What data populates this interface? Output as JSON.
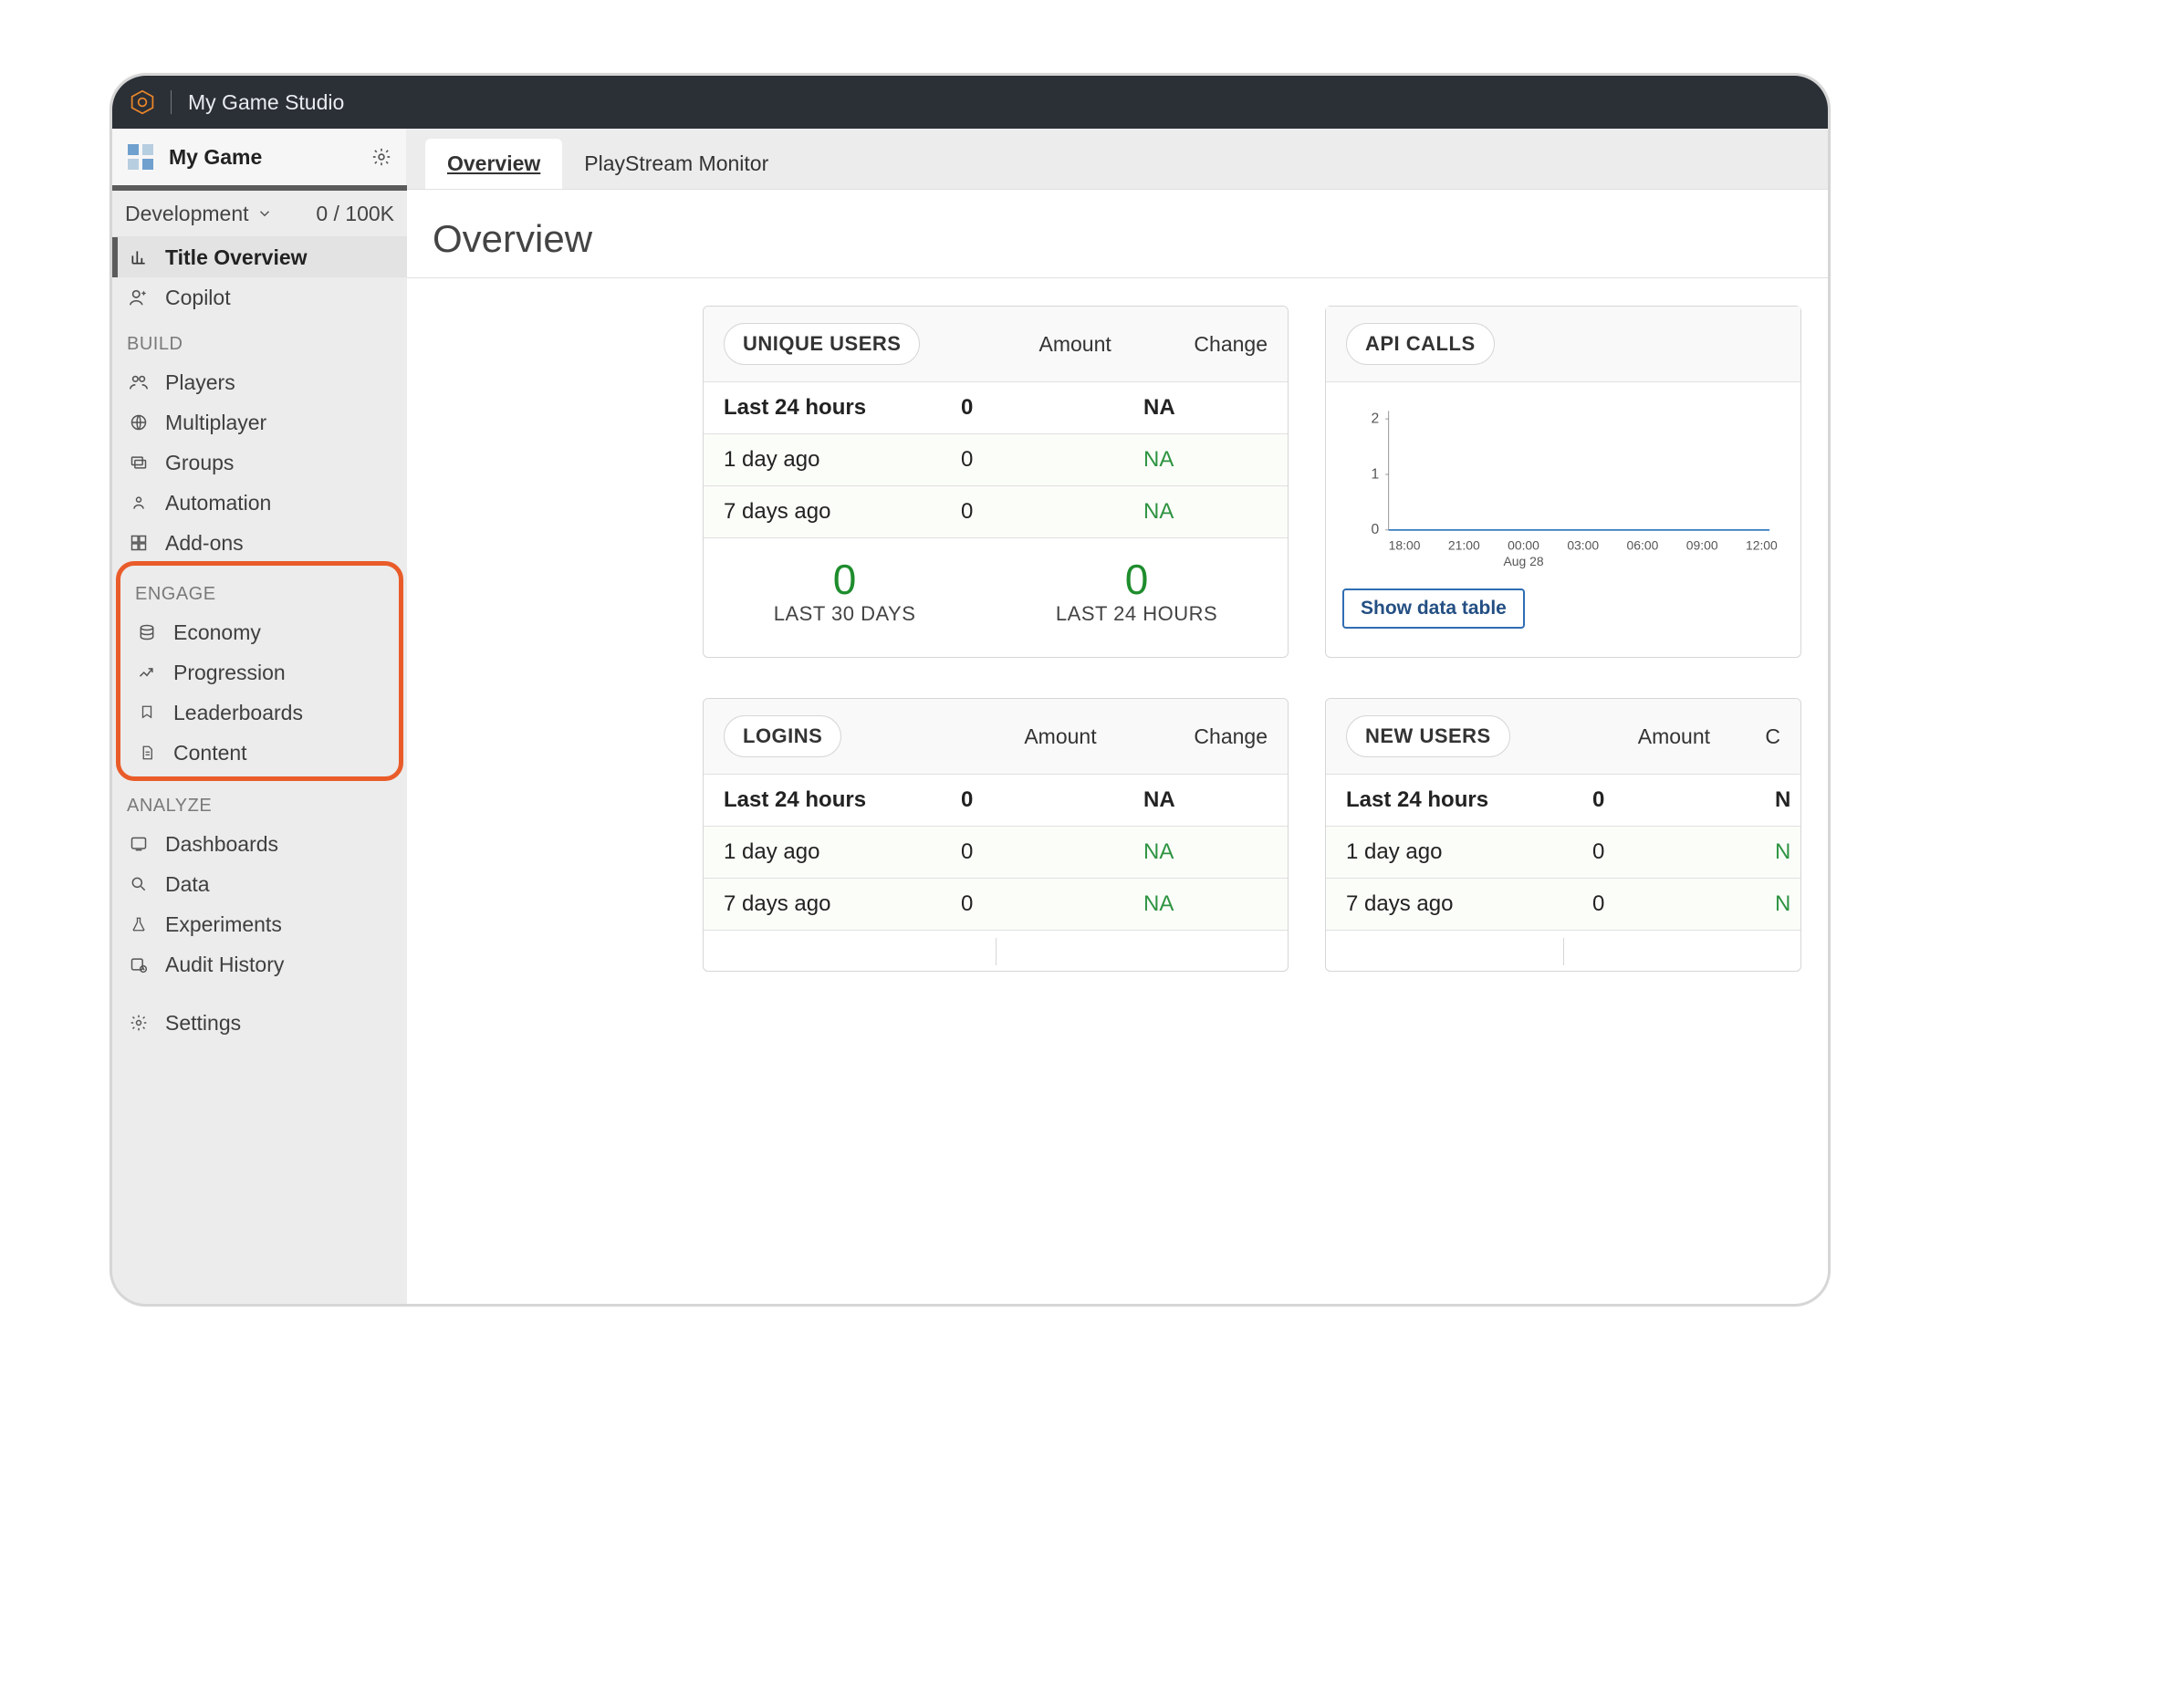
{
  "topbar": {
    "studio_name": "My Game Studio"
  },
  "sidebar": {
    "game_name": "My Game",
    "env_label": "Development",
    "env_ratio": "0 / 100K",
    "items": [
      {
        "label": "Title Overview"
      },
      {
        "label": "Copilot"
      }
    ],
    "sections": {
      "build": {
        "label": "BUILD",
        "items": [
          {
            "label": "Players"
          },
          {
            "label": "Multiplayer"
          },
          {
            "label": "Groups"
          },
          {
            "label": "Automation"
          },
          {
            "label": "Add-ons"
          }
        ]
      },
      "engage": {
        "label": "ENGAGE",
        "items": [
          {
            "label": "Economy"
          },
          {
            "label": "Progression"
          },
          {
            "label": "Leaderboards"
          },
          {
            "label": "Content"
          }
        ]
      },
      "analyze": {
        "label": "ANALYZE",
        "items": [
          {
            "label": "Dashboards"
          },
          {
            "label": "Data"
          },
          {
            "label": "Experiments"
          },
          {
            "label": "Audit History"
          }
        ]
      }
    },
    "settings_label": "Settings"
  },
  "tabs": [
    {
      "label": "Overview"
    },
    {
      "label": "PlayStream Monitor"
    }
  ],
  "page_title": "Overview",
  "cards": {
    "unique_users": {
      "title": "UNIQUE USERS",
      "col_amount": "Amount",
      "col_change": "Change",
      "rows": [
        {
          "label": "Last 24 hours",
          "amount": "0",
          "change": "NA"
        },
        {
          "label": "1 day ago",
          "amount": "0",
          "change": "NA"
        },
        {
          "label": "7 days ago",
          "amount": "0",
          "change": "NA"
        }
      ],
      "summary": [
        {
          "value": "0",
          "label": "LAST 30 DAYS"
        },
        {
          "value": "0",
          "label": "LAST 24 HOURS"
        }
      ]
    },
    "api_calls": {
      "title": "API CALLS",
      "show_table": "Show data table"
    },
    "logins": {
      "title": "LOGINS",
      "col_amount": "Amount",
      "col_change": "Change",
      "rows": [
        {
          "label": "Last 24 hours",
          "amount": "0",
          "change": "NA"
        },
        {
          "label": "1 day ago",
          "amount": "0",
          "change": "NA"
        },
        {
          "label": "7 days ago",
          "amount": "0",
          "change": "NA"
        }
      ]
    },
    "new_users": {
      "title": "NEW USERS",
      "col_amount": "Amount",
      "col_change": "C",
      "rows": [
        {
          "label": "Last 24 hours",
          "amount": "0",
          "change": "N"
        },
        {
          "label": "1 day ago",
          "amount": "0",
          "change": "N"
        },
        {
          "label": "7 days ago",
          "amount": "0",
          "change": "N"
        }
      ]
    }
  },
  "chart_data": {
    "type": "line",
    "title": "API CALLS",
    "xlabel": "",
    "ylabel": "",
    "y_ticks": [
      0,
      1,
      2
    ],
    "x_ticks": [
      "18:00",
      "21:00",
      "00:00",
      "03:00",
      "06:00",
      "09:00",
      "12:00"
    ],
    "x_sublabel": "Aug 28",
    "ylim": [
      0,
      2
    ],
    "series": [
      {
        "name": "api_calls",
        "values": [
          0,
          0,
          0,
          0,
          0,
          0,
          0
        ]
      }
    ]
  }
}
